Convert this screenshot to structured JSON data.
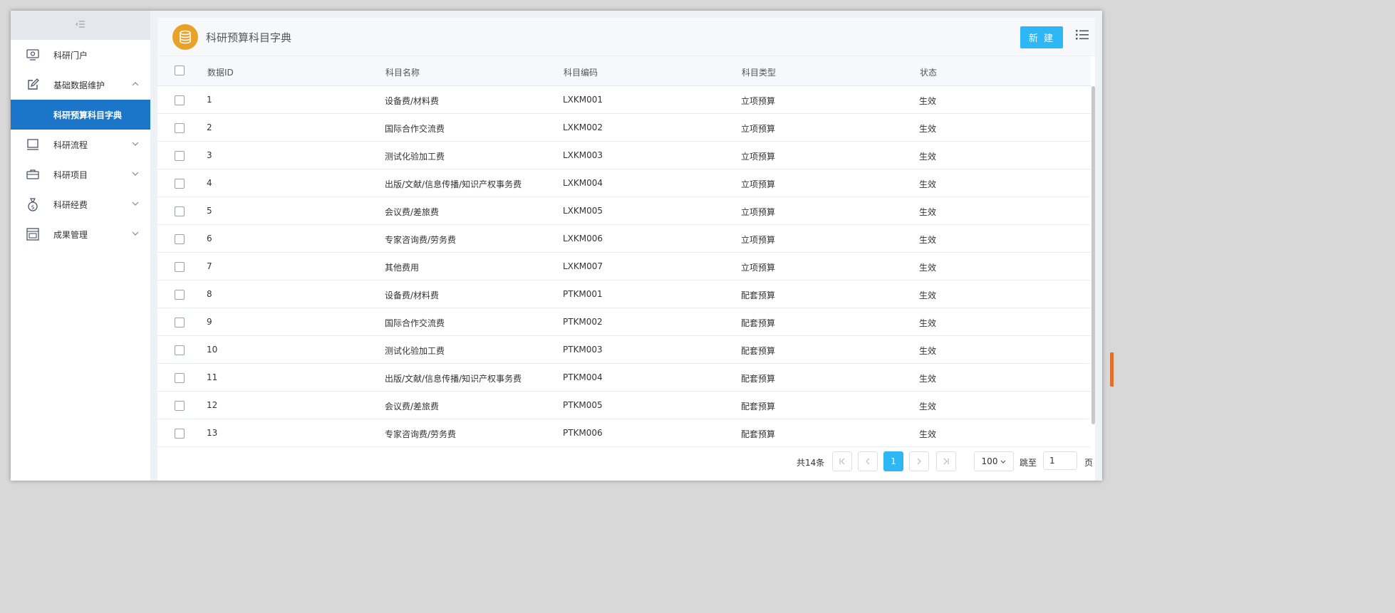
{
  "sidebar": {
    "items": [
      {
        "label": "科研门户",
        "icon": "portal-icon"
      },
      {
        "label": "基础数据维护",
        "icon": "edit-icon",
        "expanded": true,
        "children": [
          {
            "label": "科研预算科目字典",
            "active": true
          }
        ]
      },
      {
        "label": "科研流程",
        "icon": "monitor-icon"
      },
      {
        "label": "科研项目",
        "icon": "briefcase-icon"
      },
      {
        "label": "科研经费",
        "icon": "money-bag-icon"
      },
      {
        "label": "成果管理",
        "icon": "archive-icon"
      }
    ]
  },
  "header": {
    "title": "科研预算科目字典",
    "new_button": "新 建",
    "icon": "database-icon"
  },
  "table": {
    "columns": [
      "数据ID",
      "科目名称",
      "科目编码",
      "科目类型",
      "状态"
    ],
    "rows": [
      [
        "1",
        "设备费/材料费",
        "LXKM001",
        "立项预算",
        "生效"
      ],
      [
        "2",
        "国际合作交流费",
        "LXKM002",
        "立项预算",
        "生效"
      ],
      [
        "3",
        "测试化验加工费",
        "LXKM003",
        "立项预算",
        "生效"
      ],
      [
        "4",
        "出版/文献/信息传播/知识产权事务费",
        "LXKM004",
        "立项预算",
        "生效"
      ],
      [
        "5",
        "会议费/差旅费",
        "LXKM005",
        "立项预算",
        "生效"
      ],
      [
        "6",
        "专家咨询费/劳务费",
        "LXKM006",
        "立项预算",
        "生效"
      ],
      [
        "7",
        "其他费用",
        "LXKM007",
        "立项预算",
        "生效"
      ],
      [
        "8",
        "设备费/材料费",
        "PTKM001",
        "配套预算",
        "生效"
      ],
      [
        "9",
        "国际合作交流费",
        "PTKM002",
        "配套预算",
        "生效"
      ],
      [
        "10",
        "测试化验加工费",
        "PTKM003",
        "配套预算",
        "生效"
      ],
      [
        "11",
        "出版/文献/信息传播/知识产权事务费",
        "PTKM004",
        "配套预算",
        "生效"
      ],
      [
        "12",
        "会议费/差旅费",
        "PTKM005",
        "配套预算",
        "生效"
      ],
      [
        "13",
        "专家咨询费/劳务费",
        "PTKM006",
        "配套预算",
        "生效"
      ]
    ]
  },
  "pagination": {
    "total": "共14条",
    "current_page": "1",
    "page_size": "100",
    "jump_label": "跳至",
    "jump_value": "1",
    "page_suffix": "页"
  },
  "colors": {
    "accent": "#2db7f5",
    "sidebar_active": "#1b75c9",
    "logo": "#e7a227"
  }
}
